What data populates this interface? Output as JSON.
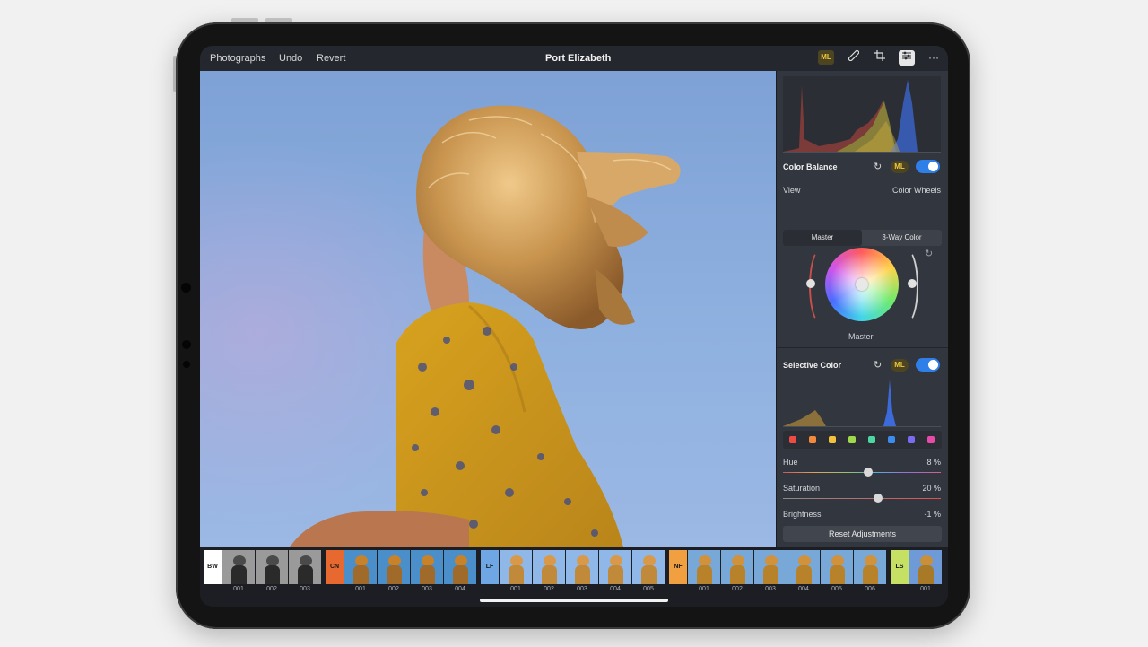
{
  "topbar": {
    "nav": [
      "Photographs",
      "Undo",
      "Revert"
    ],
    "title": "Port Elizabeth",
    "ml_label": "ML",
    "icons": [
      "healing-icon",
      "crop-icon",
      "adjustments-icon",
      "more-icon"
    ]
  },
  "color_balance": {
    "title": "Color Balance",
    "ml_label": "ML",
    "enabled": true,
    "view_label": "View",
    "view_value": "Color Wheels",
    "tabs": [
      "Master",
      "3-Way Color"
    ],
    "active_tab": "Master",
    "wheel_label": "Master"
  },
  "selective_color": {
    "title": "Selective Color",
    "ml_label": "ML",
    "enabled": true,
    "swatches": [
      "#ef4b45",
      "#f28a3c",
      "#f2c23c",
      "#9fd84a",
      "#4ad8a0",
      "#3c8cf0",
      "#7a6cf0",
      "#e84aa8"
    ],
    "hue_label": "Hue",
    "hue_value": "8 %",
    "hue_level": 0.54,
    "saturation_label": "Saturation",
    "saturation_value": "20 %",
    "saturation_level": 0.6,
    "brightness_label": "Brightness",
    "brightness_value": "-1 %",
    "reset_label": "Reset Adjustments"
  },
  "filmstrip": {
    "groups": [
      {
        "tag": "BW",
        "tag_color": "#ffffff",
        "style": "bw",
        "items": [
          "001",
          "002",
          "003"
        ]
      },
      {
        "tag": "CN",
        "tag_color": "#e8692f",
        "style": "cn",
        "items": [
          "001",
          "002",
          "003",
          "004"
        ]
      },
      {
        "tag": "LF",
        "tag_color": "#6fa6e4",
        "style": "lf",
        "items": [
          "001",
          "002",
          "003",
          "004",
          "005"
        ]
      },
      {
        "tag": "NF",
        "tag_color": "#f0a040",
        "style": "nf",
        "items": [
          "001",
          "002",
          "003",
          "004",
          "005",
          "006"
        ]
      },
      {
        "tag": "LS",
        "tag_color": "#c6e063",
        "style": "ls",
        "items": [
          "001"
        ]
      }
    ]
  }
}
